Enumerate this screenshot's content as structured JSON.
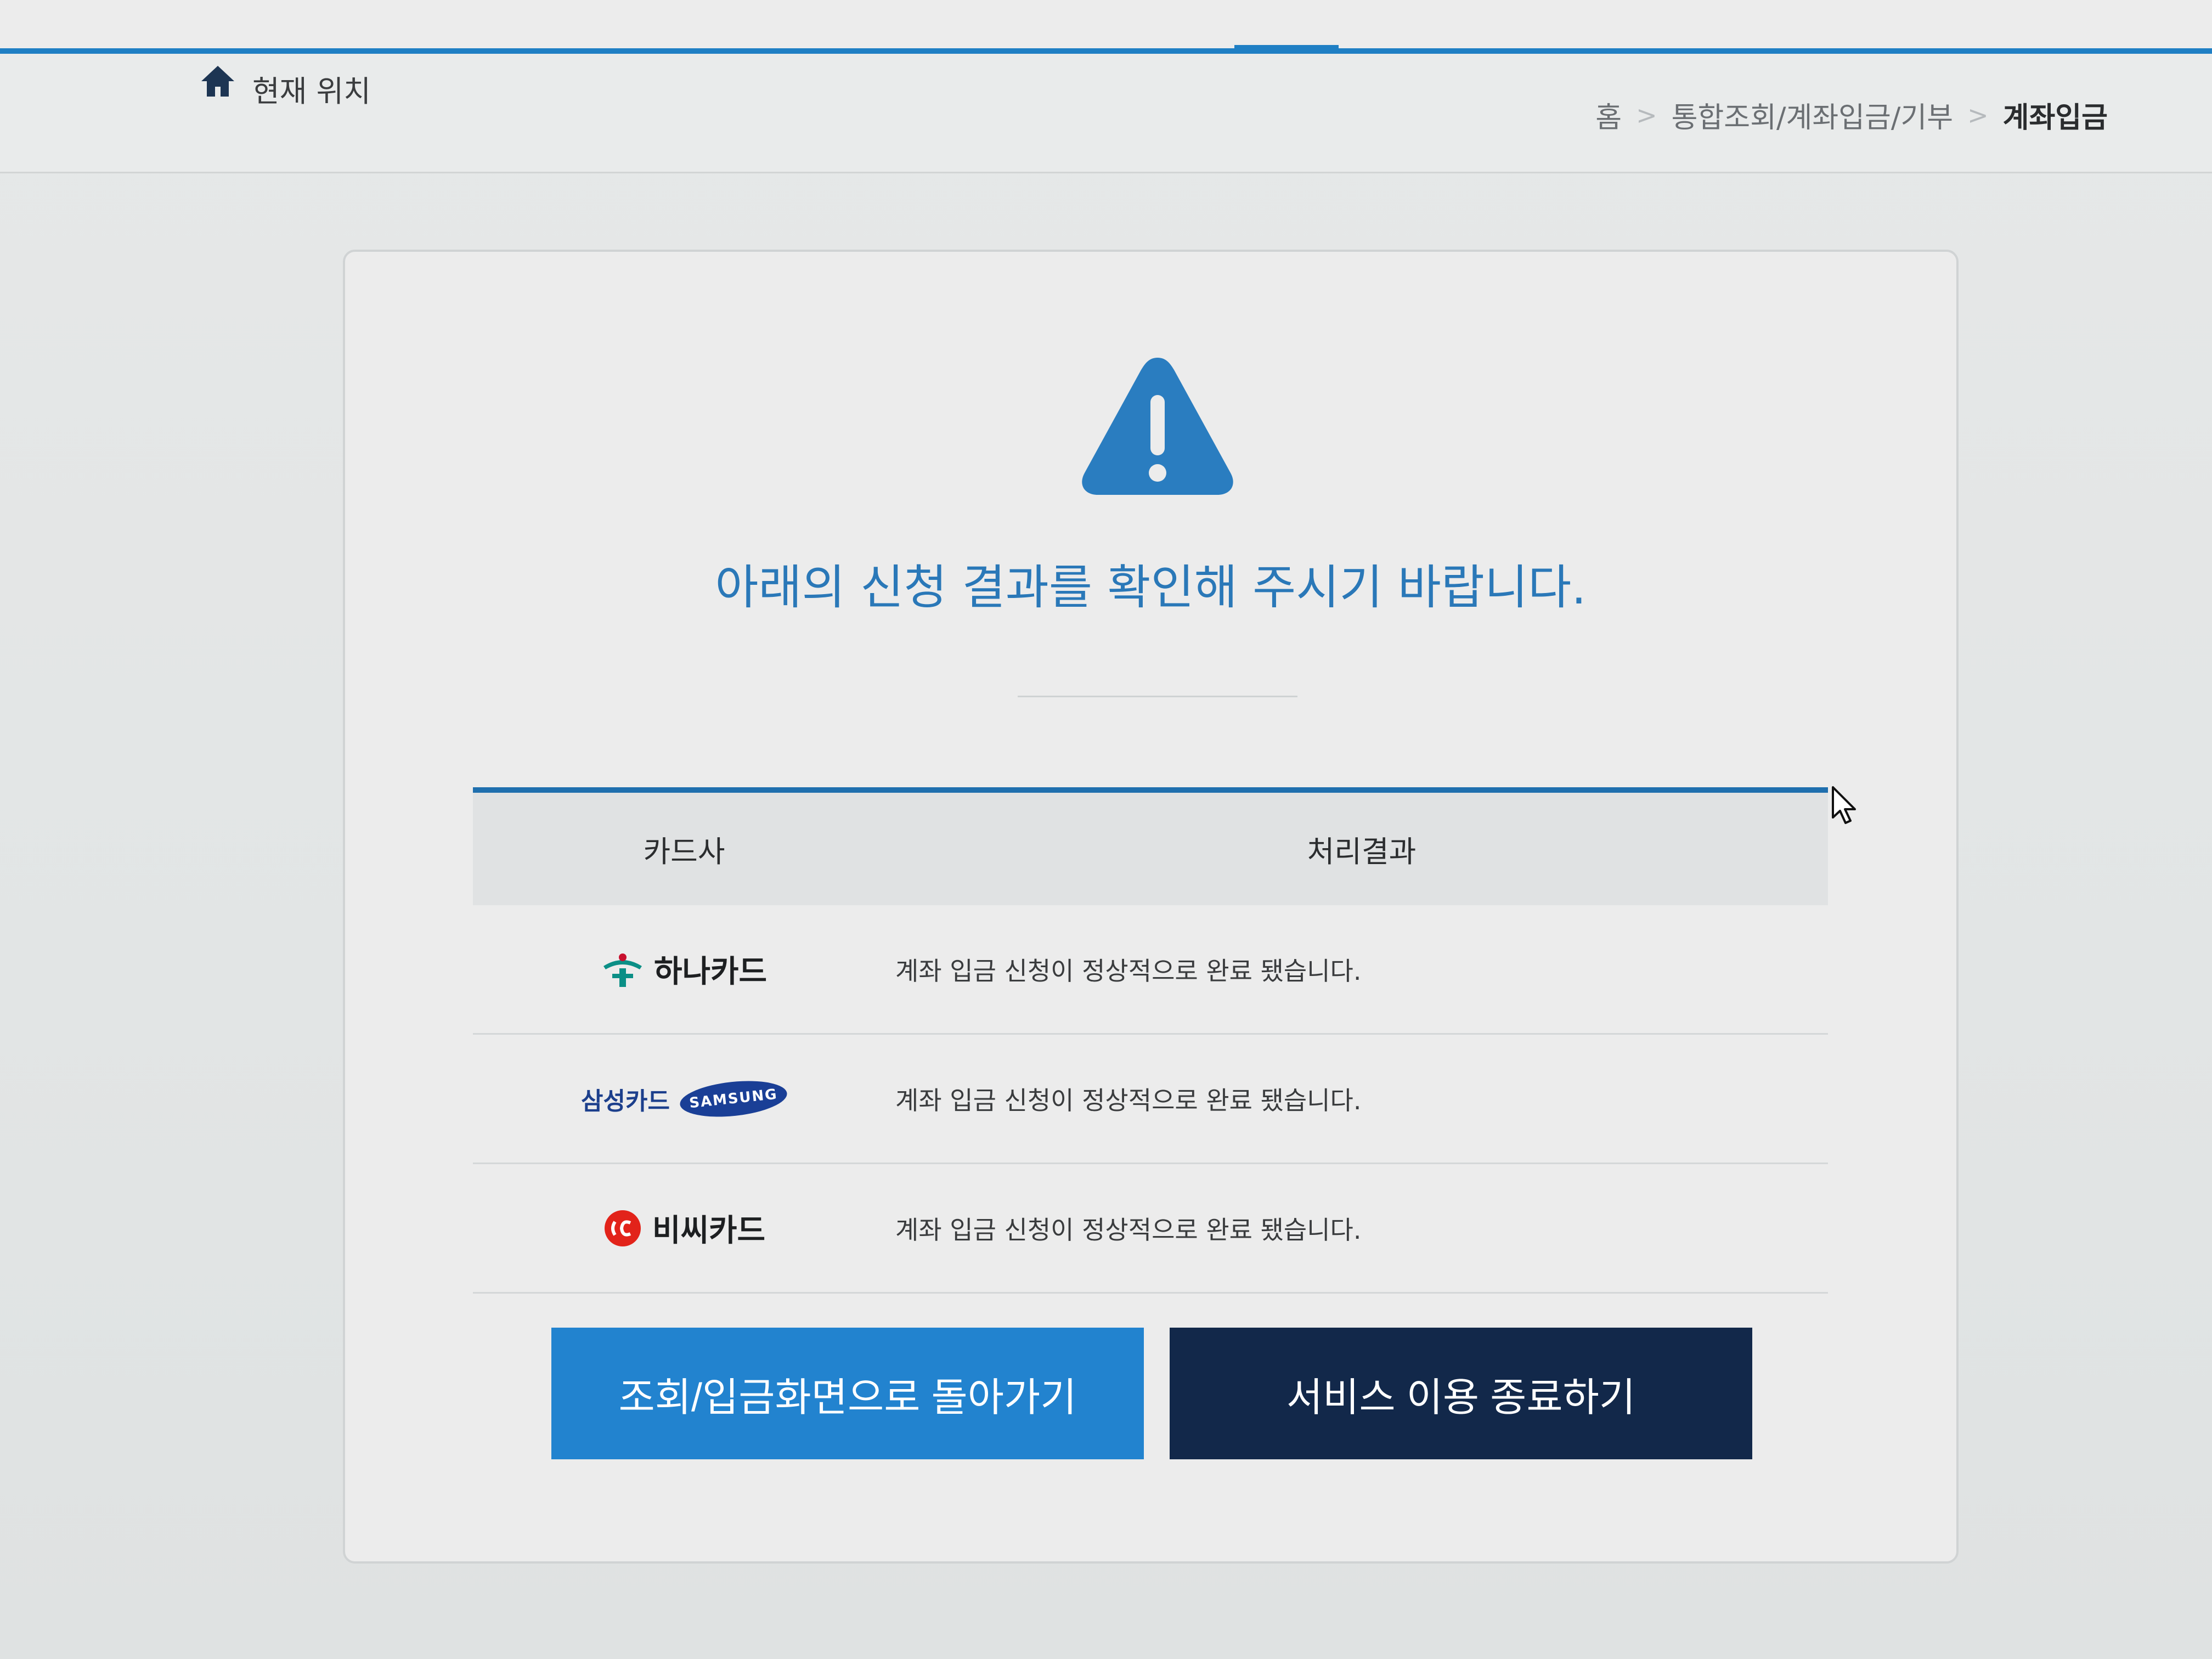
{
  "location": {
    "label": "현재 위치",
    "breadcrumb": [
      "홈",
      "통합조회/계좌입금/기부",
      "계좌입금"
    ]
  },
  "headline": "아래의 신청 결과를 확인해 주시기 바랍니다.",
  "table": {
    "headers": {
      "card": "카드사",
      "result": "처리결과"
    },
    "rows": [
      {
        "card": "하나카드",
        "result": "계좌 입금 신청이 정상적으로 완료 됐습니다."
      },
      {
        "card": "삼성카드",
        "logo_text": "SAMSUNG",
        "result": "계좌 입금 신청이 정상적으로 완료 됐습니다."
      },
      {
        "card": "비씨카드",
        "result": "계좌 입금 신청이 정상적으로 완료 됐습니다."
      }
    ]
  },
  "buttons": {
    "back": "조회/입금화면으로 돌아가기",
    "exit": "서비스 이용 종료하기"
  },
  "colors": {
    "accent": "#1f7fc4",
    "headline": "#2a78b8",
    "back_button": "#2283cf",
    "exit_button": "#12284a"
  },
  "icons": [
    "home-icon",
    "warning-icon",
    "hana-logo-icon",
    "bc-logo-icon",
    "mouse-cursor-icon"
  ]
}
